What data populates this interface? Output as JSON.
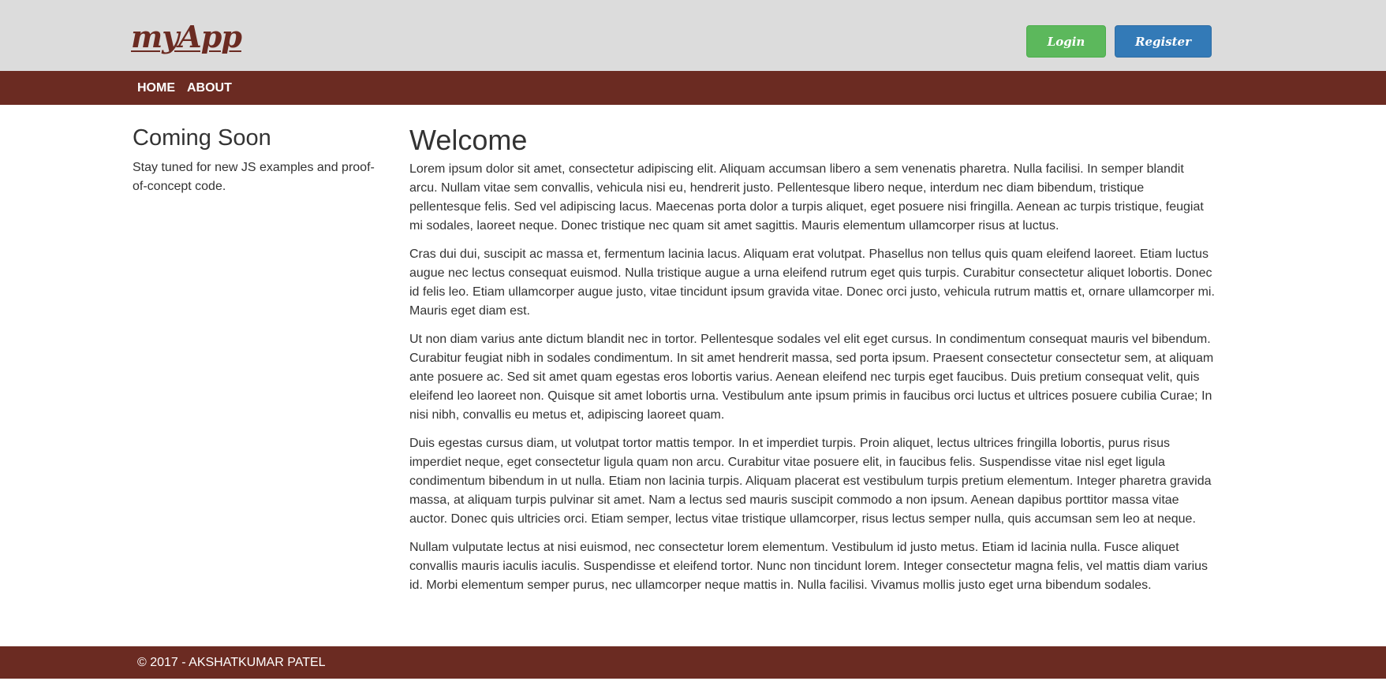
{
  "header": {
    "logo": "myApp",
    "login_label": "Login",
    "register_label": "Register"
  },
  "nav": {
    "items": [
      {
        "label": "HOME"
      },
      {
        "label": "ABOUT"
      }
    ]
  },
  "sidebar": {
    "heading": "Coming Soon",
    "text": "Stay tuned for new JS examples and proof-of-concept code."
  },
  "main": {
    "heading": "Welcome",
    "paragraphs": [
      "Lorem ipsum dolor sit amet, consectetur adipiscing elit. Aliquam accumsan libero a sem venenatis pharetra. Nulla facilisi. In semper blandit arcu. Nullam vitae sem convallis, vehicula nisi eu, hendrerit justo. Pellentesque libero neque, interdum nec diam bibendum, tristique pellentesque felis. Sed vel adipiscing lacus. Maecenas porta dolor a turpis aliquet, eget posuere nisi fringilla. Aenean ac turpis tristique, feugiat mi sodales, laoreet neque. Donec tristique nec quam sit amet sagittis. Mauris elementum ullamcorper risus at luctus.",
      "Cras dui dui, suscipit ac massa et, fermentum lacinia lacus. Aliquam erat volutpat. Phasellus non tellus quis quam eleifend laoreet. Etiam luctus augue nec lectus consequat euismod. Nulla tristique augue a urna eleifend rutrum eget quis turpis. Curabitur consectetur aliquet lobortis. Donec id felis leo. Etiam ullamcorper augue justo, vitae tincidunt ipsum gravida vitae. Donec orci justo, vehicula rutrum mattis et, ornare ullamcorper mi. Mauris eget diam est.",
      "Ut non diam varius ante dictum blandit nec in tortor. Pellentesque sodales vel elit eget cursus. In condimentum consequat mauris vel bibendum. Curabitur feugiat nibh in sodales condimentum. In sit amet hendrerit massa, sed porta ipsum. Praesent consectetur consectetur sem, at aliquam ante posuere ac. Sed sit amet quam egestas eros lobortis varius. Aenean eleifend nec turpis eget faucibus. Duis pretium consequat velit, quis eleifend leo laoreet non. Quisque sit amet lobortis urna. Vestibulum ante ipsum primis in faucibus orci luctus et ultrices posuere cubilia Curae; In nisi nibh, convallis eu metus et, adipiscing laoreet quam.",
      "Duis egestas cursus diam, ut volutpat tortor mattis tempor. In et imperdiet turpis. Proin aliquet, lectus ultrices fringilla lobortis, purus risus imperdiet neque, eget consectetur ligula quam non arcu. Curabitur vitae posuere elit, in faucibus felis. Suspendisse vitae nisl eget ligula condimentum bibendum in ut nulla. Etiam non lacinia turpis. Aliquam placerat est vestibulum turpis pretium elementum. Integer pharetra gravida massa, at aliquam turpis pulvinar sit amet. Nam a lectus sed mauris suscipit commodo a non ipsum. Aenean dapibus porttitor massa vitae auctor. Donec quis ultricies orci. Etiam semper, lectus vitae tristique ullamcorper, risus lectus semper nulla, quis accumsan sem leo at neque.",
      "Nullam vulputate lectus at nisi euismod, nec consectetur lorem elementum. Vestibulum id justo metus. Etiam id lacinia nulla. Fusce aliquet convallis mauris iaculis iaculis. Suspendisse et eleifend tortor. Nunc non tincidunt lorem. Integer consectetur magna felis, vel mattis diam varius id. Morbi elementum semper purus, nec ullamcorper neque mattis in. Nulla facilisi. Vivamus mollis justo eget urna bibendum sodales."
    ]
  },
  "footer": {
    "text": "© 2017 - AKSHATKUMAR PATEL"
  },
  "colors": {
    "brand": "#6b2b22",
    "header_bg": "#dcdcdc",
    "login_button": "#5cb85c",
    "register_button": "#337ab7"
  }
}
